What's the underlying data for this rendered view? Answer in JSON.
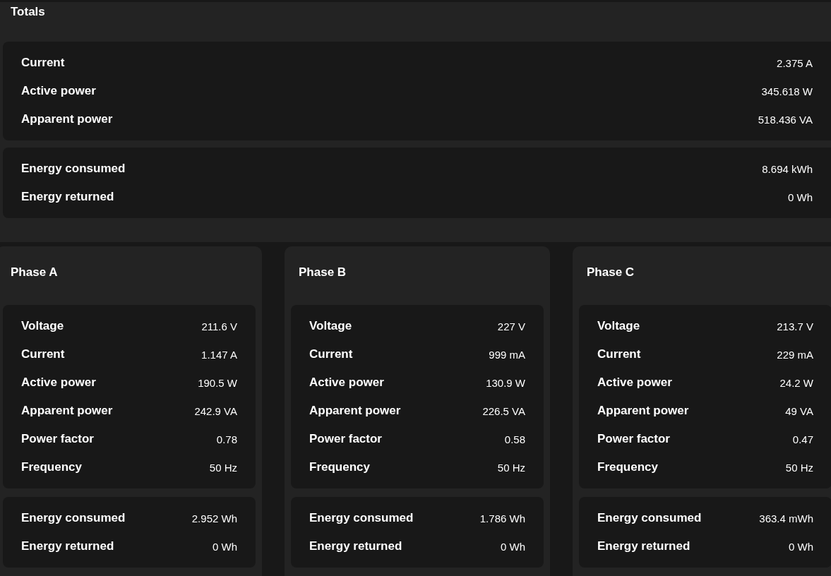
{
  "totals": {
    "title": "Totals",
    "groups": [
      [
        {
          "label": "Current",
          "value": "2.375 A"
        },
        {
          "label": "Active power",
          "value": "345.618 W"
        },
        {
          "label": "Apparent power",
          "value": "518.436 VA"
        }
      ],
      [
        {
          "label": "Energy consumed",
          "value": "8.694 kWh"
        },
        {
          "label": "Energy returned",
          "value": "0 Wh"
        }
      ]
    ]
  },
  "phases": [
    {
      "title": "Phase A",
      "groups": [
        [
          {
            "label": "Voltage",
            "value": "211.6 V"
          },
          {
            "label": "Current",
            "value": "1.147 A"
          },
          {
            "label": "Active power",
            "value": "190.5 W"
          },
          {
            "label": "Apparent power",
            "value": "242.9 VA"
          },
          {
            "label": "Power factor",
            "value": "0.78"
          },
          {
            "label": "Frequency",
            "value": "50 Hz"
          }
        ],
        [
          {
            "label": "Energy consumed",
            "value": "2.952 Wh"
          },
          {
            "label": "Energy returned",
            "value": "0 Wh"
          }
        ]
      ]
    },
    {
      "title": "Phase B",
      "groups": [
        [
          {
            "label": "Voltage",
            "value": "227 V"
          },
          {
            "label": "Current",
            "value": "999 mA"
          },
          {
            "label": "Active power",
            "value": "130.9 W"
          },
          {
            "label": "Apparent power",
            "value": "226.5 VA"
          },
          {
            "label": "Power factor",
            "value": "0.58"
          },
          {
            "label": "Frequency",
            "value": "50 Hz"
          }
        ],
        [
          {
            "label": "Energy consumed",
            "value": "1.786 Wh"
          },
          {
            "label": "Energy returned",
            "value": "0 Wh"
          }
        ]
      ]
    },
    {
      "title": "Phase C",
      "groups": [
        [
          {
            "label": "Voltage",
            "value": "213.7 V"
          },
          {
            "label": "Current",
            "value": "229 mA"
          },
          {
            "label": "Active power",
            "value": "24.2 W"
          },
          {
            "label": "Apparent power",
            "value": "49 VA"
          },
          {
            "label": "Power factor",
            "value": "0.47"
          },
          {
            "label": "Frequency",
            "value": "50 Hz"
          }
        ],
        [
          {
            "label": "Energy consumed",
            "value": "363.4 mWh"
          },
          {
            "label": "Energy returned",
            "value": "0 Wh"
          }
        ]
      ]
    }
  ]
}
